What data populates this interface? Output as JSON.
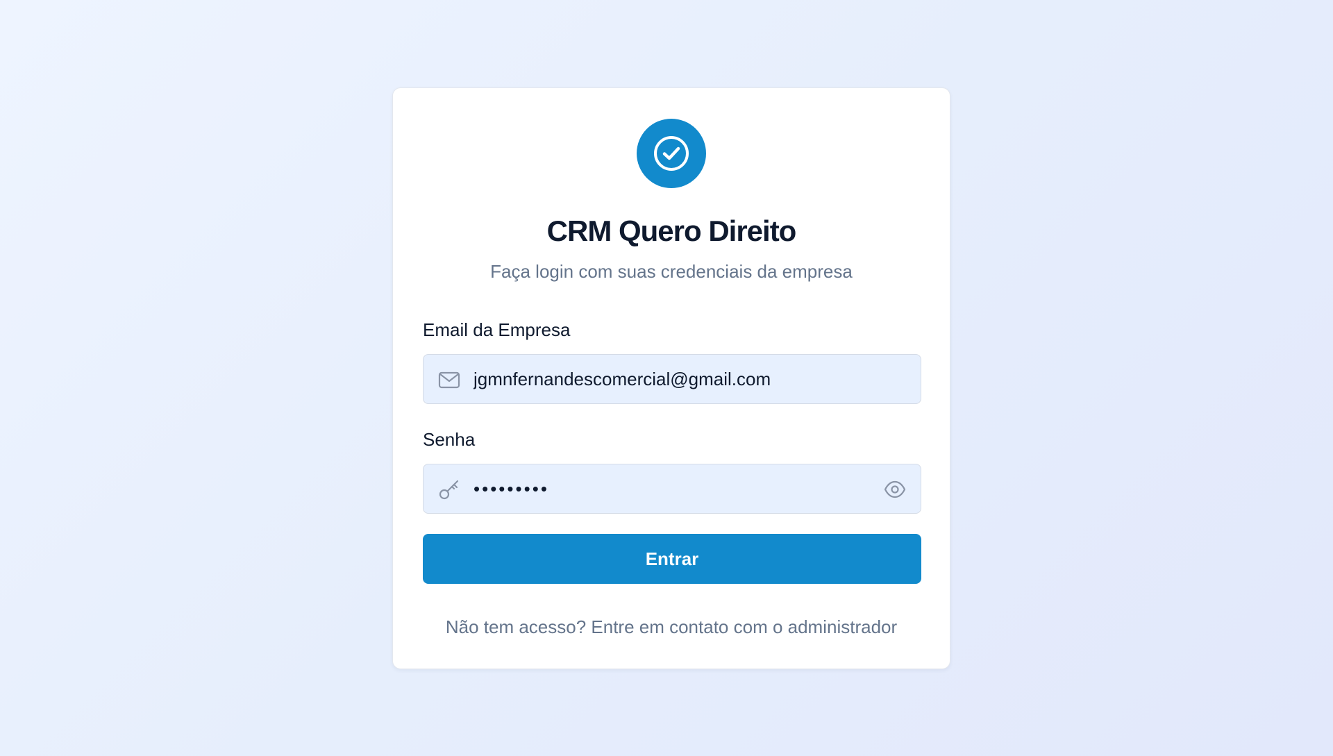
{
  "app": {
    "title": "CRM Quero Direito",
    "subtitle": "Faça login com suas credenciais da empresa",
    "logo_icon": "check-circle-icon",
    "accent_color": "#128acc"
  },
  "form": {
    "email": {
      "label": "Email da Empresa",
      "value": "jgmnfernandescomercial@gmail.com",
      "icon": "mail-icon"
    },
    "password": {
      "label": "Senha",
      "value": "•••••••••",
      "icon": "key-icon",
      "toggle_icon": "eye-icon"
    },
    "submit_label": "Entrar"
  },
  "footer": {
    "text": "Não tem acesso? Entre em contato com o administrador"
  }
}
